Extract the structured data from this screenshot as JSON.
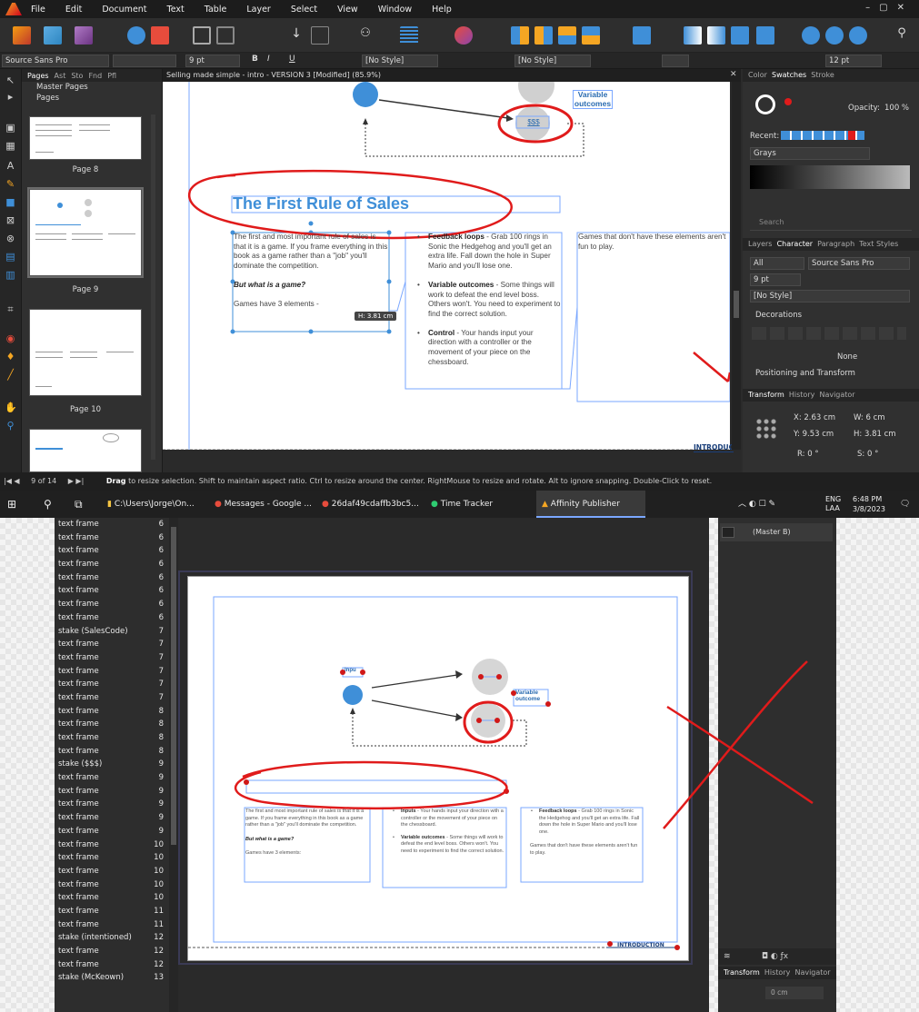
{
  "menu": [
    "File",
    "Edit",
    "Document",
    "Text",
    "Table",
    "Layer",
    "Select",
    "View",
    "Window",
    "Help"
  ],
  "context_toolbar": {
    "font_family": "Source Sans Pro",
    "font_size": "9 pt",
    "bold": "B",
    "italic": "I",
    "underline": "U",
    "paragraph_style": "[No Style]",
    "character_style": "[No Style]",
    "leading": "12 pt"
  },
  "pages_panel": {
    "tabs": [
      "Pages",
      "Ast",
      "Sto",
      "Fnd",
      "Pfl"
    ],
    "master_pages": "Master Pages",
    "pages": "Pages",
    "thumb_labels": [
      "Page 8",
      "Page 9",
      "Page 10"
    ]
  },
  "document_tab": "Selling made simple - intro - VERSION 3 [Modified] (85.9%)",
  "page_content": {
    "variable_label": "Variable\noutcomes",
    "sss": "$$$",
    "heading": "The First Rule of Sales",
    "col1_p1": "The first and most important rule of sales is that it is a game. If you frame everything in this book as a game rather than a \"job\" you'll dominate the competition.",
    "col1_p2": "But what is a game?",
    "col1_p3": "Games have 3 elements -",
    "height_tip": "H: 3.81 cm",
    "b1_title": "Feedback loops",
    "b1_text": " - Grab 100 rings in Sonic the Hedgehog and you'll get an extra life. Fall down the hole in Super Mario and you'll lose one.",
    "b2_title": "Variable outcomes",
    "b2_text": " - Some things will work to defeat the end level boss. Others won't. You need to experiment to find the correct solution.",
    "b3_title": "Control",
    "b3_text": " - Your hands input your direction with a controller or the movement of your piece on the chessboard.",
    "col3_text": "Games that don't have these elements aren't fun to play.",
    "footer_tag": "INTRODUC"
  },
  "right_panel": {
    "color_tabs": [
      "Color",
      "Swatches",
      "Stroke"
    ],
    "opacity_label": "Opacity:",
    "opacity": "100 %",
    "recent": "Recent:",
    "palette": "Grays",
    "search": "Search",
    "char_tabs": [
      "Layers",
      "Character",
      "Paragraph",
      "Text Styles"
    ],
    "char_all": "All",
    "char_font": "Source Sans Pro",
    "char_size": "9 pt",
    "char_style": "[No Style]",
    "decorations": "Decorations",
    "none": "None",
    "positioning": "Positioning and Transform",
    "transform_tabs": [
      "Transform",
      "History",
      "Navigator"
    ],
    "x": "X: 2.63 cm",
    "y": "Y: 9.53 cm",
    "w": "W: 6 cm",
    "h": "H: 3.81 cm",
    "r": "R: 0 °",
    "s": "S: 0 °"
  },
  "statusbar": {
    "page": "9 of 14",
    "hint_drag": "Drag",
    "hint_rest": " to resize selection. Shift to maintain aspect ratio. Ctrl to resize around the center. RightMouse to resize and rotate. Alt to ignore snapping. Double-Click to reset."
  },
  "taskbar": {
    "items": [
      "C:\\Users\\Jorge\\On...",
      "Messages - Google ...",
      "26daf49cdaffb3bc5...",
      "Time Tracker",
      "Affinity Publisher"
    ],
    "lang": "ENG\nLAA",
    "time": "6:48 PM",
    "date": "3/8/2023"
  },
  "layers": [
    [
      "text frame",
      "6"
    ],
    [
      "text frame",
      "6"
    ],
    [
      "text frame",
      "6"
    ],
    [
      "text frame",
      "6"
    ],
    [
      "text frame",
      "6"
    ],
    [
      "text frame",
      "6"
    ],
    [
      "text frame",
      "6"
    ],
    [
      "text frame",
      "6"
    ],
    [
      "stake (SalesCode)",
      "7"
    ],
    [
      "text frame",
      "7"
    ],
    [
      "text frame",
      "7"
    ],
    [
      "text frame",
      "7"
    ],
    [
      "text frame",
      "7"
    ],
    [
      "text frame",
      "7"
    ],
    [
      "text frame",
      "8"
    ],
    [
      "text frame",
      "8"
    ],
    [
      "text frame",
      "8"
    ],
    [
      "text frame",
      "8"
    ],
    [
      "stake ($$$)",
      "9"
    ],
    [
      "text frame",
      "9"
    ],
    [
      "text frame",
      "9"
    ],
    [
      "text frame",
      "9"
    ],
    [
      "text frame",
      "9"
    ],
    [
      "text frame",
      "9"
    ],
    [
      "text frame",
      "10"
    ],
    [
      "text frame",
      "10"
    ],
    [
      "text frame",
      "10"
    ],
    [
      "text frame",
      "10"
    ],
    [
      "text frame",
      "10"
    ],
    [
      "text frame",
      "11"
    ],
    [
      "text frame",
      "11"
    ],
    [
      "stake (intentioned)",
      "12"
    ],
    [
      "text frame",
      "12"
    ],
    [
      "text frame",
      "12"
    ],
    [
      "stake (McKeown)",
      "13"
    ]
  ],
  "page2": {
    "inpu": "Inpu",
    "variable": "Variable\noutcome",
    "col1_p1": "The first and most important rule of sales is that it is a game. If you frame everything in this book as a game rather than a \"job\" you'll dominate the competition.",
    "col1_p2": "But what is a game?",
    "col1_p3": "Games have 3 elements:",
    "b1_title": "Inputs",
    "b1_text": " - Your hands input your direction with a controller or the movement of your piece on the chessboard.",
    "b2_title": "Variable outcomes",
    "b2_text": " - Some things will work to defeat the end level boss. Others won't. You need to experiment to find the correct solution.",
    "b3_title": "Feedback loops",
    "b3_text": " - Grab 100 rings in Sonic the Hedgehog and you'll get an extra life. Fall down the hole in Super Mario and you'll lose one.",
    "col3_text": "Games that don't have these elements aren't fun to play.",
    "footer_tag": "INTRODUCTION",
    "master": "(Master B)",
    "transform_tabs": [
      "Transform",
      "History",
      "Navigator"
    ],
    "x_value": "0 cm"
  },
  "colors": {
    "accent_blue": "#3f8fd8",
    "annotation_red": "#e01b1b",
    "panel_dark": "#2b2b2b"
  }
}
